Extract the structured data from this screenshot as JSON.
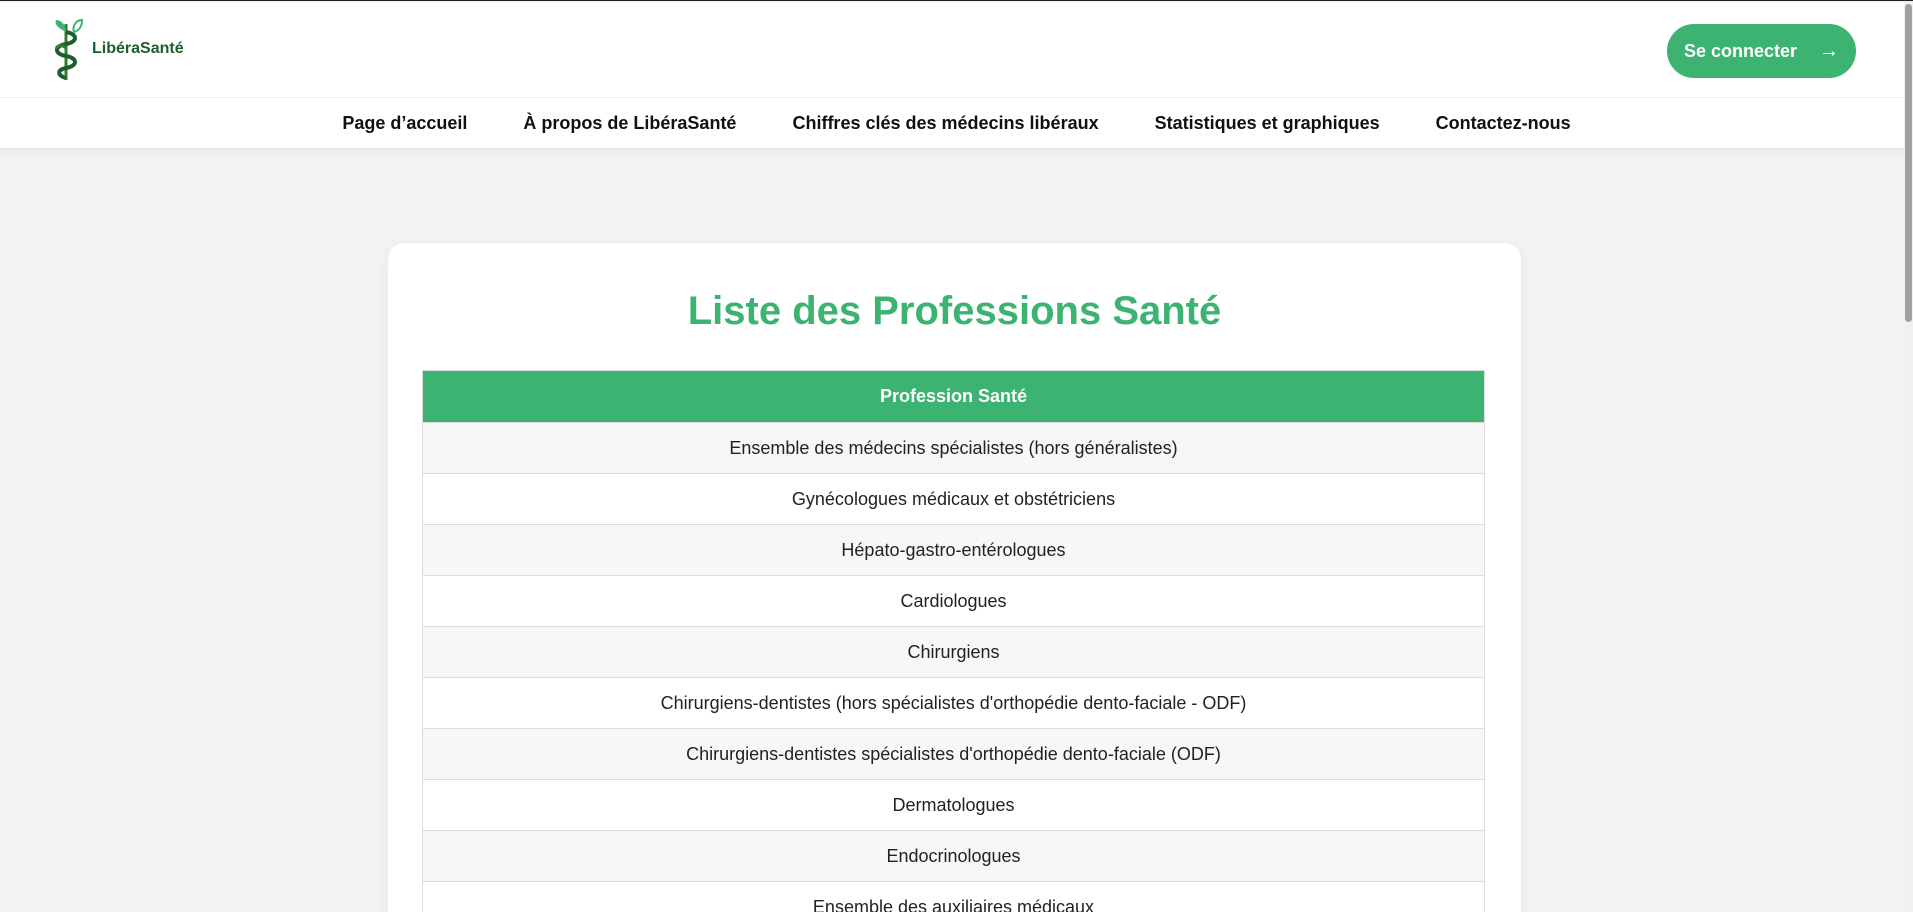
{
  "brand": {
    "name": "LibéraSanté"
  },
  "header": {
    "login_label": "Se connecter",
    "login_arrow": "→"
  },
  "nav": [
    "Page d’accueil",
    "À propos de LibéraSanté",
    "Chiffres clés des médecins libéraux",
    "Statistiques et graphiques",
    "Contactez-nous"
  ],
  "main": {
    "title": "Liste des Professions Santé",
    "table": {
      "header": "Profession Santé",
      "rows": [
        "Ensemble des médecins spécialistes (hors généralistes)",
        "Gynécologues médicaux et obstétriciens",
        "Hépato-gastro-entérologues",
        "Cardiologues",
        "Chirurgiens",
        "Chirurgiens-dentistes (hors spécialistes d'orthopédie dento-faciale - ODF)",
        "Chirurgiens-dentistes spécialistes d'orthopédie dento-faciale (ODF)",
        "Dermatologues",
        "Endocrinologues",
        "Ensemble des auxiliaires médicaux"
      ]
    }
  },
  "colors": {
    "accent": "#3cb371",
    "brand_dark": "#1e5e2a"
  }
}
